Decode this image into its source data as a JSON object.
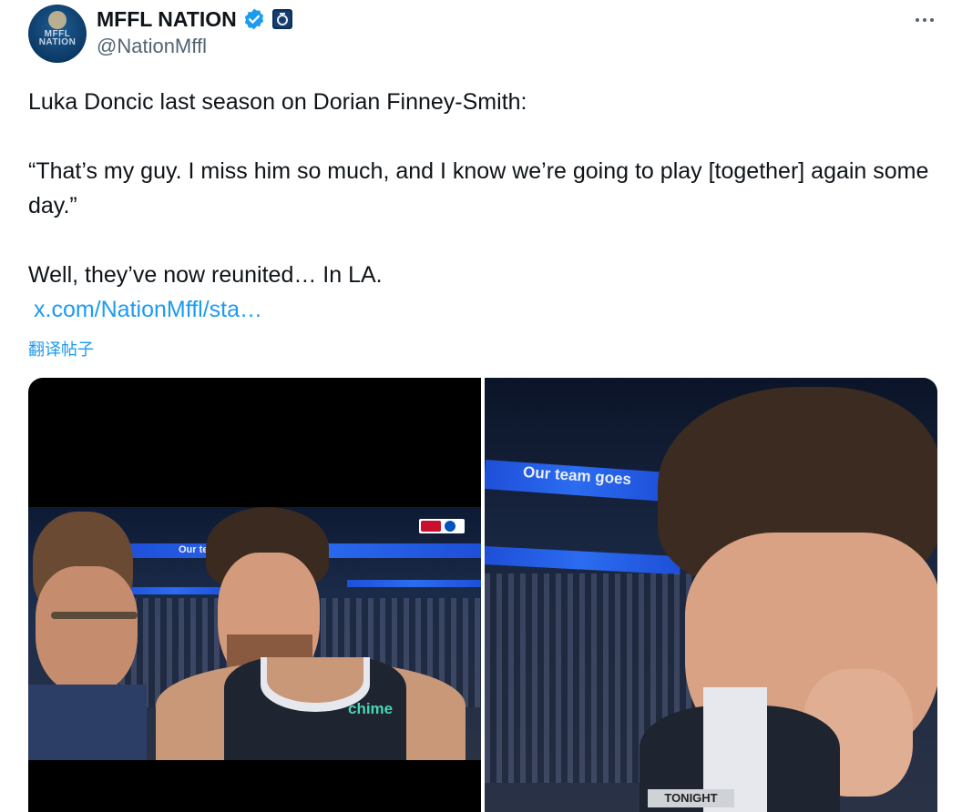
{
  "author": {
    "display_name": "MFFL NATION",
    "handle": "@NationMffl",
    "avatar_lettering": "MFFL\nNATION"
  },
  "icons": {
    "verified": "verified-badge-icon",
    "affiliate": "affiliate-badge-icon",
    "more": "more-options-icon"
  },
  "post": {
    "line1": "Luka Doncic last season on Dorian Finney-Smith:",
    "quote": "“That’s my guy. I miss him so much, and I know we’re going to play [together] again some day.”",
    "line3": "Well, they’ve now reunited… In LA.",
    "link": "x.com/NationMffl/sta…",
    "translate": "翻译帖子"
  },
  "media": {
    "left": {
      "led_text": "Our te",
      "jersey_text": "chime"
    },
    "right": {
      "led_text": "Our team goes",
      "ticker": "TONIGHT"
    }
  },
  "colors": {
    "link": "#1d9bf0",
    "verified": "#1d9bf0",
    "muted": "#536471"
  }
}
